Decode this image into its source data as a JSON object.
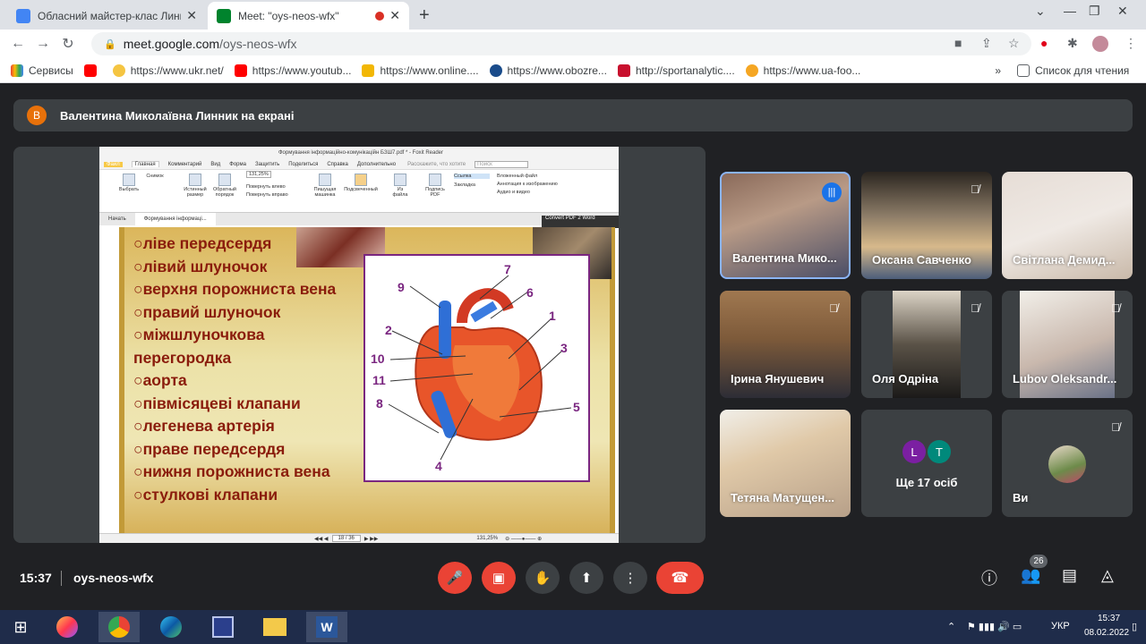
{
  "browser": {
    "tabs": [
      {
        "title": "Обласний майстер-клас Линник"
      },
      {
        "title": "Meet: \"oys-neos-wfx\""
      }
    ],
    "url_host": "meet.google.com",
    "url_path": "/oys-neos-wfx",
    "bookmarks": [
      {
        "label": "Сервисы"
      },
      {
        "label": ""
      },
      {
        "label": "https://www.ukr.net/"
      },
      {
        "label": "https://www.youtub..."
      },
      {
        "label": "https://www.online...."
      },
      {
        "label": "https://www.obozre..."
      },
      {
        "label": "http://sportanalytic...."
      },
      {
        "label": "https://www.ua-foo..."
      }
    ],
    "reading_list": "Список для чтения"
  },
  "meet": {
    "presenter_initial": "В",
    "presenter_banner": "Валентина Миколаївна Линник на екрані",
    "participants": [
      {
        "name": "Валентина Мико..."
      },
      {
        "name": "Оксана Савченко"
      },
      {
        "name": "Світлана Демид..."
      },
      {
        "name": "Ірина Янушевич"
      },
      {
        "name": "Оля Одріна"
      },
      {
        "name": "Lubov Oleksandr..."
      },
      {
        "name": "Тетяна Матущен..."
      }
    ],
    "more_avatars": [
      "L",
      "T"
    ],
    "more_label": "Ще 17 осіб",
    "self_label": "Ви",
    "time": "15:37",
    "meeting_code": "oys-neos-wfx",
    "people_count": "26"
  },
  "reader": {
    "title": "Формування інформаційно-комунікаційн БЗШ7.pdf * - Foxit Reader",
    "menu": [
      "Файл",
      "Главная",
      "Комментарий",
      "Вид",
      "Форма",
      "Защитить",
      "Поделиться",
      "Справка",
      "Дополнительно"
    ],
    "search_hint": "Расскажите, что хотите",
    "search_placeholder": "Поиск",
    "ribbon": [
      "Выбрать",
      "Снимок",
      "Истинный размер",
      "Обратный порядок",
      "131,25%",
      "Повернуть влево",
      "Повернуть вправо",
      "Пишущая машинка",
      "Подсвеченный",
      "Из файла",
      "Подпись PDF",
      "Ссылка",
      "Закладка",
      "Вложенный файл",
      "Аннотация к изображению",
      "Аудио и видео"
    ],
    "doc_tabs": [
      "Начать",
      "Формування інформаці..."
    ],
    "page_indicator": "18 / 36",
    "zoom": "131,25%",
    "convert_label": "Convert PDF 2 Word"
  },
  "slide": {
    "items": [
      "○ліве передсердя",
      "○лівий шлуночок",
      "○верхня порожниста вена",
      "○правий шлуночок",
      "○міжшлуночкова",
      "перегородка",
      "○аорта",
      "○півмісяцеві клапани",
      "○легенева артерія",
      "○праве передсердя",
      "○нижня порожниста вена",
      "○стулкові клапани"
    ],
    "heart_labels": [
      "7",
      "9",
      "6",
      "1",
      "2",
      "3",
      "10",
      "11",
      "8",
      "5",
      "4"
    ]
  },
  "taskbar": {
    "lang": "УКР",
    "time": "15:37",
    "date": "08.02.2022"
  }
}
